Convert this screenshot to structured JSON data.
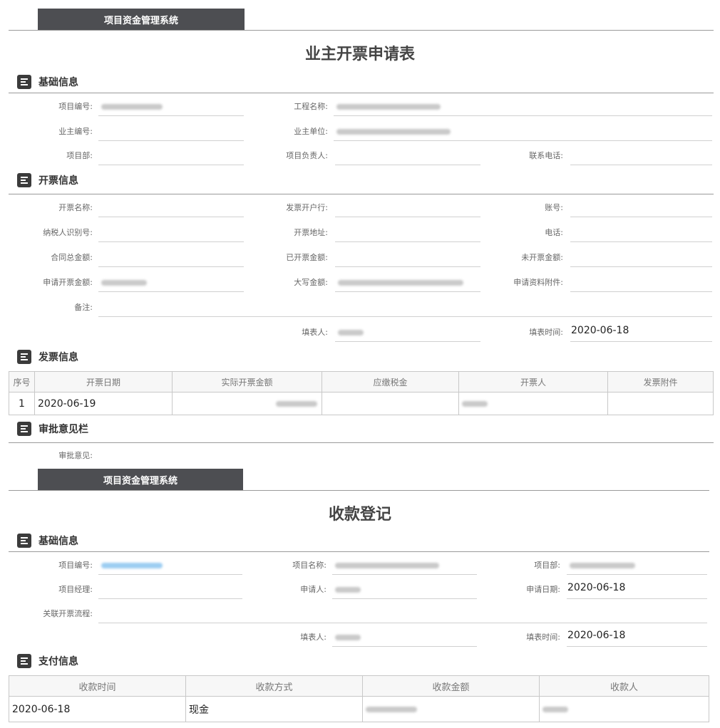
{
  "system_name": "项目资金管理系统",
  "form1": {
    "title": "业主开票申请表",
    "sections": {
      "basic": "基础信息",
      "invoice": "开票信息",
      "receipts": "发票信息",
      "approval": "审批意见栏"
    },
    "labels": {
      "project_no": "项目编号:",
      "project_name": "工程名称:",
      "owner_no": "业主编号:",
      "owner_unit": "业主单位:",
      "dept": "项目部:",
      "manager": "项目负责人:",
      "phone": "联系电话:",
      "invoice_name": "开票名称:",
      "bank": "发票开户行:",
      "account": "账号:",
      "tax_id": "纳税人识别号:",
      "address": "开票地址:",
      "tel": "电话:",
      "contract_total": "合同总金额:",
      "invoiced": "已开票金额:",
      "uninvoiced": "未开票金额:",
      "apply_amount": "申请开票金额:",
      "amount_words": "大写金额:",
      "attachments": "申请资料附件:",
      "remark": "备注:",
      "filler": "填表人:",
      "fill_time": "填表时间:",
      "approval": "审批意见:"
    },
    "fill_time_value": "2020-06-18",
    "invoice_table": {
      "headers": [
        "序号",
        "开票日期",
        "实际开票金额",
        "应缴税金",
        "开票人",
        "发票附件"
      ],
      "rows": [
        {
          "no": "1",
          "date": "2020-06-19"
        }
      ]
    }
  },
  "form2": {
    "title": "收款登记",
    "sections": {
      "basic": "基础信息",
      "payment": "支付信息"
    },
    "labels": {
      "project_no": "项目编号:",
      "project_name": "项目名称:",
      "dept": "项目部:",
      "manager": "项目经理:",
      "applicant": "申请人:",
      "apply_date": "申请日期:",
      "linked_flow": "关联开票流程:",
      "filler": "填表人:",
      "fill_time": "填表时间:"
    },
    "apply_date_value": "2020-06-18",
    "fill_time_value": "2020-06-18",
    "payment_table": {
      "headers": [
        "收款时间",
        "收款方式",
        "收款金额",
        "收款人"
      ],
      "rows": [
        {
          "time": "2020-06-18",
          "method": "现金"
        }
      ]
    }
  }
}
